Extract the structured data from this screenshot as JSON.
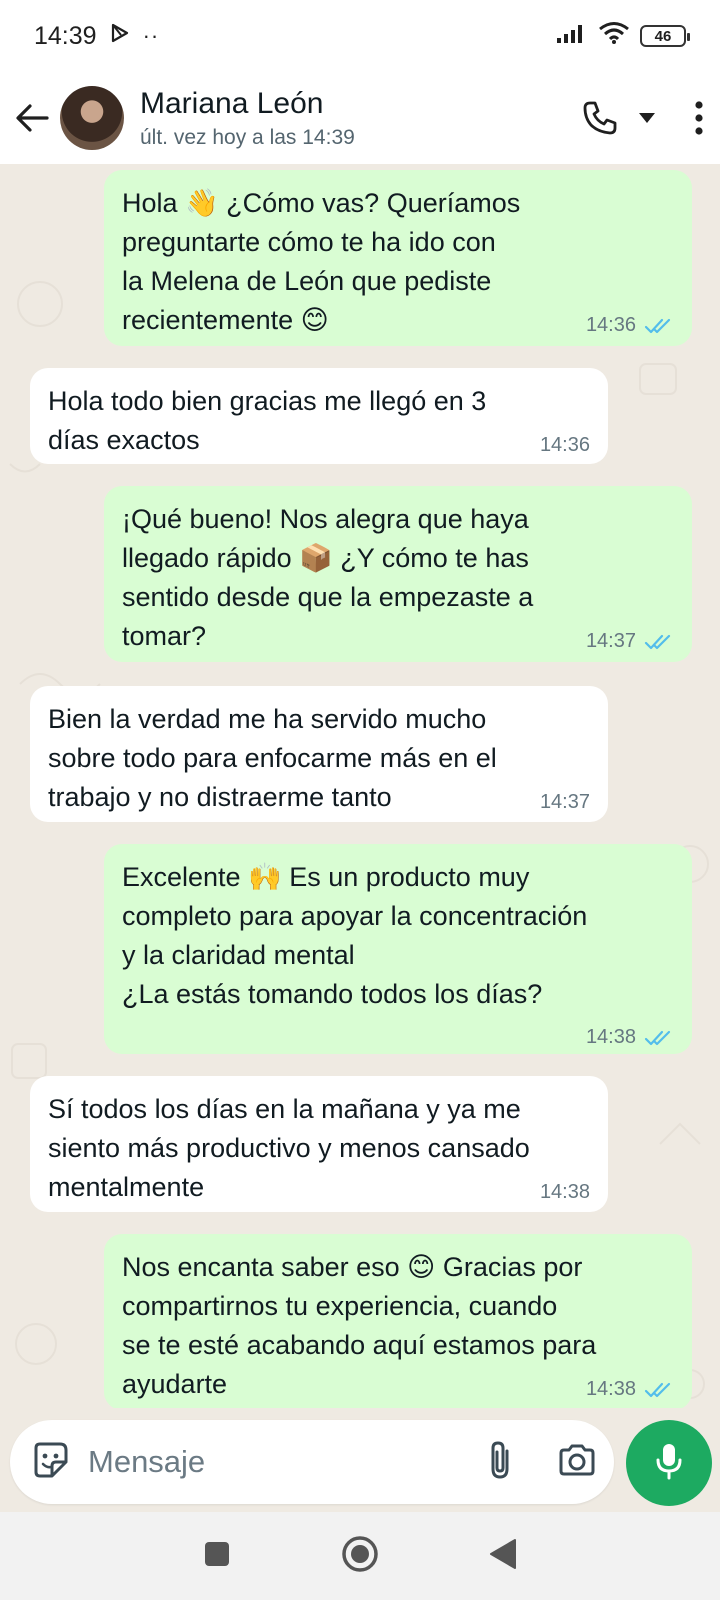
{
  "status_bar": {
    "time": "14:39",
    "battery": "46"
  },
  "header": {
    "contact_name": "Mariana León",
    "contact_status": "últ. vez hoy a las 14:39"
  },
  "messages": [
    {
      "direction": "out",
      "text": "Hola 👋 ¿Cómo vas? Queríamos\npreguntarte cómo te ha ido con\nla Melena de León que pediste\nrecientemente 😊",
      "time": "14:36",
      "read": true
    },
    {
      "direction": "in",
      "text": "Hola todo bien gracias me llegó en 3\ndías exactos",
      "time": "14:36"
    },
    {
      "direction": "out",
      "text": "¡Qué bueno! Nos alegra que haya\nllegado rápido 📦 ¿Y cómo te has\nsentido desde que la empezaste a\ntomar?",
      "time": "14:37",
      "read": true
    },
    {
      "direction": "in",
      "text": "Bien la verdad me ha servido mucho\nsobre todo para enfocarme más en el\ntrabajo y no distraerme tanto",
      "time": "14:37"
    },
    {
      "direction": "out",
      "text": "Excelente 🙌 Es un producto muy\ncompleto para apoyar la concentración\ny la claridad mental\n¿La estás tomando todos los días?",
      "time": "14:38",
      "read": true
    },
    {
      "direction": "in",
      "text": "Sí todos los días en la mañana y ya me\nsiento más productivo y menos cansado\nmentalmente",
      "time": "14:38"
    },
    {
      "direction": "out",
      "text": "Nos encanta saber eso 😊 Gracias por\ncompartirnos tu experiencia, cuando\nse te esté acabando aquí estamos para\nayudarte",
      "time": "14:38",
      "read": true
    }
  ],
  "input": {
    "placeholder": "Mensaje"
  },
  "colors": {
    "outgoing_bubble": "#d9fdd3",
    "incoming_bubble": "#ffffff",
    "chat_background": "#efeae2",
    "read_ticks": "#53bdeb",
    "mic_button": "#1daa61"
  },
  "icons": {
    "header": [
      "back-arrow-icon",
      "phone-icon",
      "dropdown-icon",
      "more-vert-icon"
    ],
    "input": [
      "sticker-icon",
      "attach-icon",
      "camera-icon",
      "mic-icon"
    ],
    "nav": [
      "recents-icon",
      "home-icon",
      "back-icon"
    ]
  }
}
